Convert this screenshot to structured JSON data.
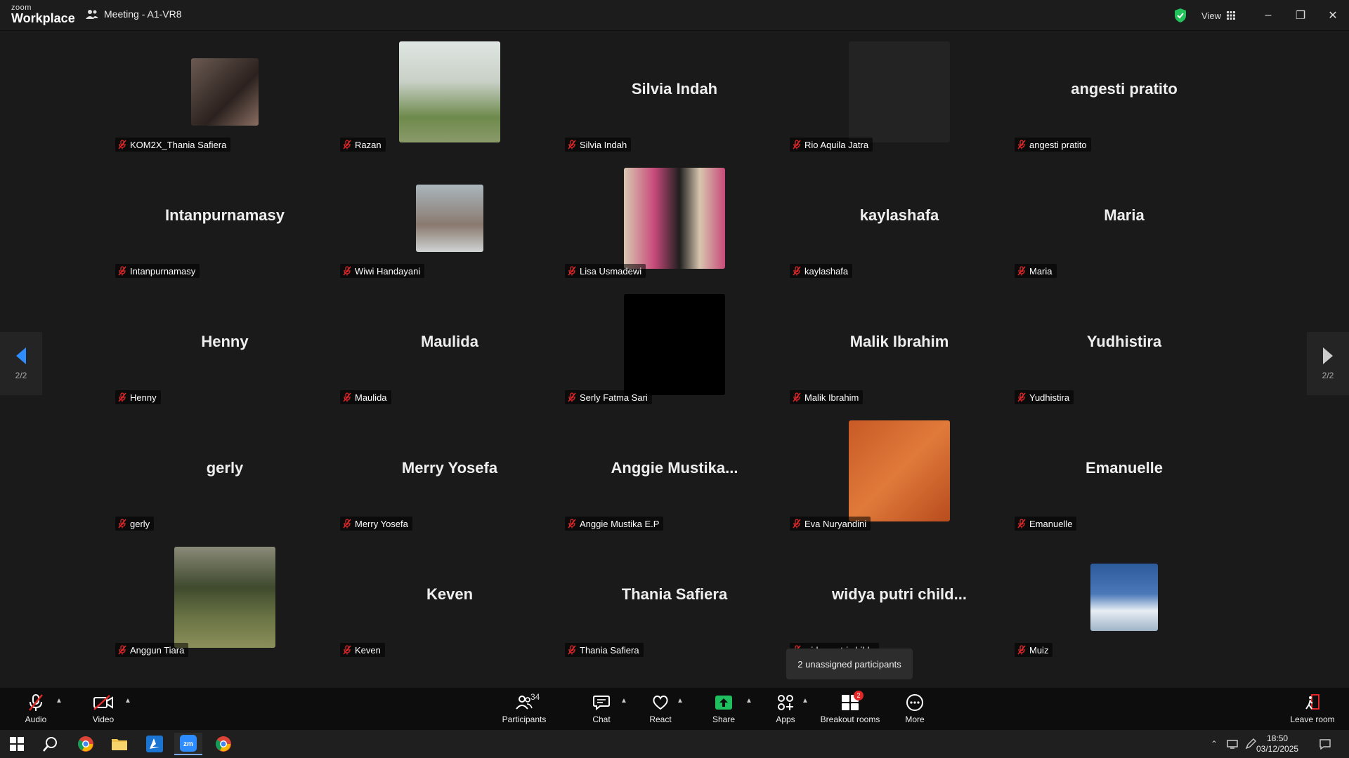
{
  "window": {
    "logo_top": "zoom",
    "logo_bottom": "Workplace",
    "meeting_title": "Meeting - A1-VR8",
    "view_label": "View",
    "minimize": "–",
    "maximize": "❐",
    "close": "✕"
  },
  "pager": {
    "left_page": "2/2",
    "right_page": "2/2"
  },
  "participants": [
    {
      "label": "KOM2X_Thania Safiera",
      "display": "",
      "has_video": true
    },
    {
      "label": "Razan",
      "display": "",
      "has_video": true
    },
    {
      "label": "Silvia Indah",
      "display": "Silvia Indah",
      "has_video": false
    },
    {
      "label": "Rio Aquila Jatra",
      "display": "",
      "has_video": true
    },
    {
      "label": "angesti pratito",
      "display": "angesti pratito",
      "has_video": false
    },
    {
      "label": "Intanpurnamasy",
      "display": "Intanpurnamasy",
      "has_video": false
    },
    {
      "label": "Wiwi Handayani",
      "display": "",
      "has_video": true
    },
    {
      "label": "Lisa Usmadewi",
      "display": "",
      "has_video": true
    },
    {
      "label": "kaylashafa",
      "display": "kaylashafa",
      "has_video": false
    },
    {
      "label": "Maria",
      "display": "Maria",
      "has_video": false
    },
    {
      "label": "Henny",
      "display": "Henny",
      "has_video": false
    },
    {
      "label": "Maulida",
      "display": "Maulida",
      "has_video": false
    },
    {
      "label": "Serly Fatma Sari",
      "display": "",
      "has_video": true
    },
    {
      "label": "Malik Ibrahim",
      "display": "Malik Ibrahim",
      "has_video": false
    },
    {
      "label": "Yudhistira",
      "display": "Yudhistira",
      "has_video": false
    },
    {
      "label": "gerly",
      "display": "gerly",
      "has_video": false
    },
    {
      "label": "Merry Yosefa",
      "display": "Merry Yosefa",
      "has_video": false
    },
    {
      "label": "Anggie Mustika E.P",
      "display": "Anggie  Mustika...",
      "has_video": false
    },
    {
      "label": "Eva Nuryandini",
      "display": "",
      "has_video": true
    },
    {
      "label": "Emanuelle",
      "display": "Emanuelle",
      "has_video": false
    },
    {
      "label": "Anggun Tiara",
      "display": "",
      "has_video": true
    },
    {
      "label": "Keven",
      "display": "Keven",
      "has_video": false
    },
    {
      "label": "Thania Safiera",
      "display": "Thania Safiera",
      "has_video": false
    },
    {
      "label": "widya putri childa",
      "display": "widya putri child...",
      "has_video": false
    },
    {
      "label": "Muiz",
      "display": "",
      "has_video": true
    }
  ],
  "tooltip": "2 unassigned participants",
  "toolbar": {
    "audio": "Audio",
    "video": "Video",
    "participants": "Participants",
    "participants_count": "34",
    "chat": "Chat",
    "react": "React",
    "share": "Share",
    "apps": "Apps",
    "breakout": "Breakout rooms",
    "breakout_badge": "2",
    "more": "More",
    "leave": "Leave room"
  },
  "taskbar": {
    "time": "18:50",
    "date": "03/12/2025"
  },
  "colors": {
    "accent_blue": "#2d8cff",
    "share_green": "#1fbf5f",
    "mute_red": "#e02828",
    "shield_green": "#23c25a"
  }
}
